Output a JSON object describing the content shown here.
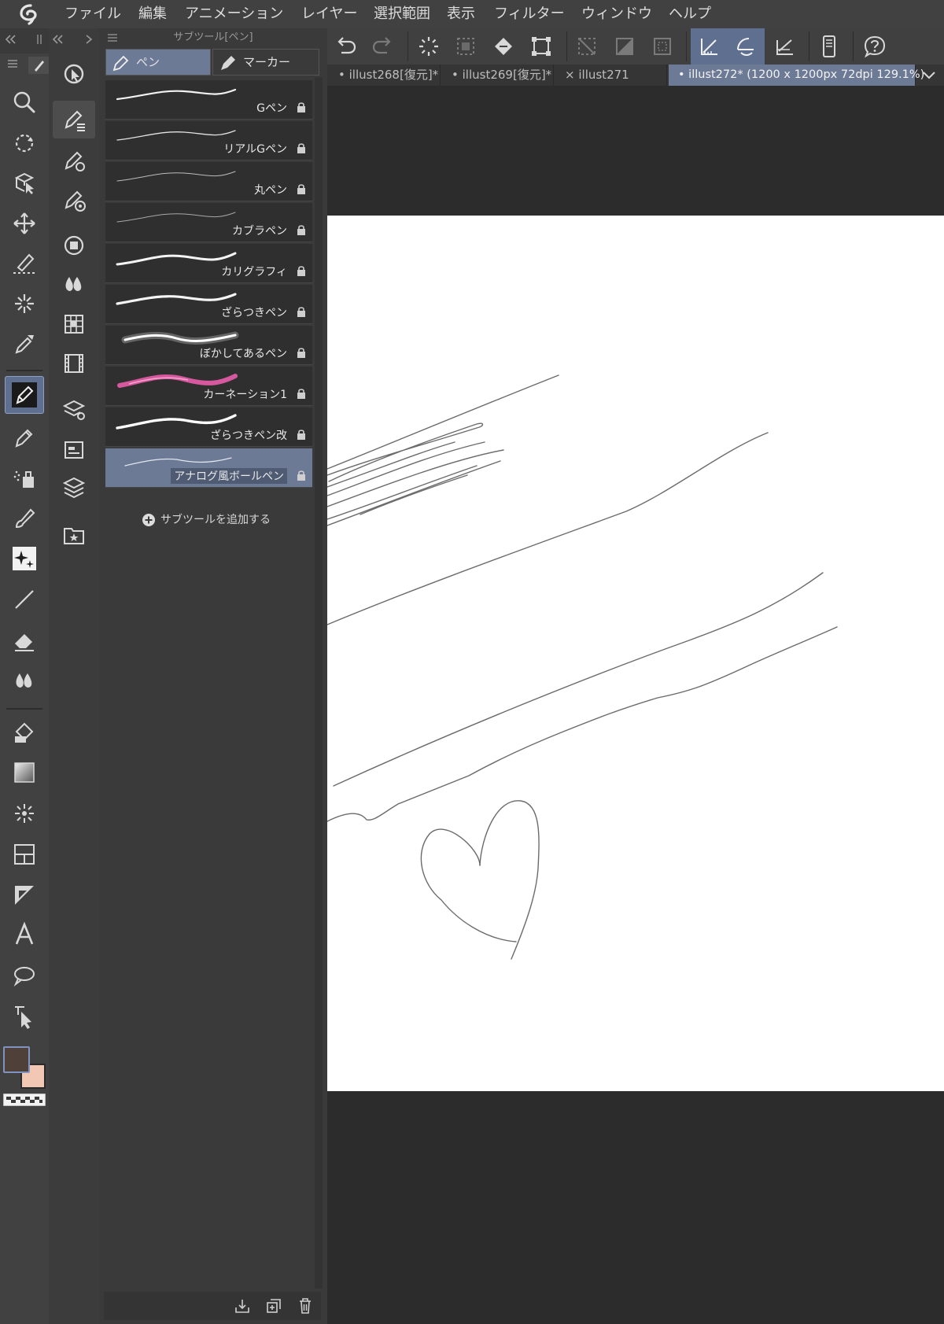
{
  "menu": {
    "items": [
      "ファイル",
      "編集",
      "アニメーション",
      "レイヤー",
      "選択範囲",
      "表示",
      "フィルター",
      "ウィンドウ",
      "ヘルプ"
    ]
  },
  "subtool_panel": {
    "title": "サブツール[ペン]",
    "tabs": [
      {
        "label": "ペン",
        "selected": true
      },
      {
        "label": "マーカー",
        "selected": false
      }
    ],
    "brushes": [
      {
        "name": "Gペン",
        "locked": true,
        "selected": false
      },
      {
        "name": "リアルGペン",
        "locked": true,
        "selected": false
      },
      {
        "name": "丸ペン",
        "locked": true,
        "selected": false
      },
      {
        "name": "カブラペン",
        "locked": true,
        "selected": false
      },
      {
        "name": "カリグラフィ",
        "locked": true,
        "selected": false
      },
      {
        "name": "ざらつきペン",
        "locked": true,
        "selected": false
      },
      {
        "name": "ぼかしてあるペン",
        "locked": true,
        "selected": false
      },
      {
        "name": "カーネーション1",
        "locked": true,
        "selected": false,
        "stroke_color": "#d6589e"
      },
      {
        "name": "ざらつきペン改",
        "locked": true,
        "selected": false
      },
      {
        "name": "アナログ風ボールペン",
        "locked": true,
        "selected": true
      }
    ],
    "add_label": "サブツールを追加する"
  },
  "tabs": [
    {
      "label": "illust268[復元]*",
      "active": false,
      "marker": "dot"
    },
    {
      "label": "illust269[復元]*",
      "active": false,
      "marker": "dot"
    },
    {
      "label": "illust271",
      "active": false,
      "marker": "close"
    },
    {
      "label": "illust272* (1200 x 1200px 72dpi 129.1%)",
      "active": true,
      "marker": "dot"
    }
  ],
  "colors": {
    "main": "#4f413a",
    "sub": "#f2c8b4",
    "accent": "#6d7a96",
    "canvas_stroke": "#6b6b6b"
  }
}
